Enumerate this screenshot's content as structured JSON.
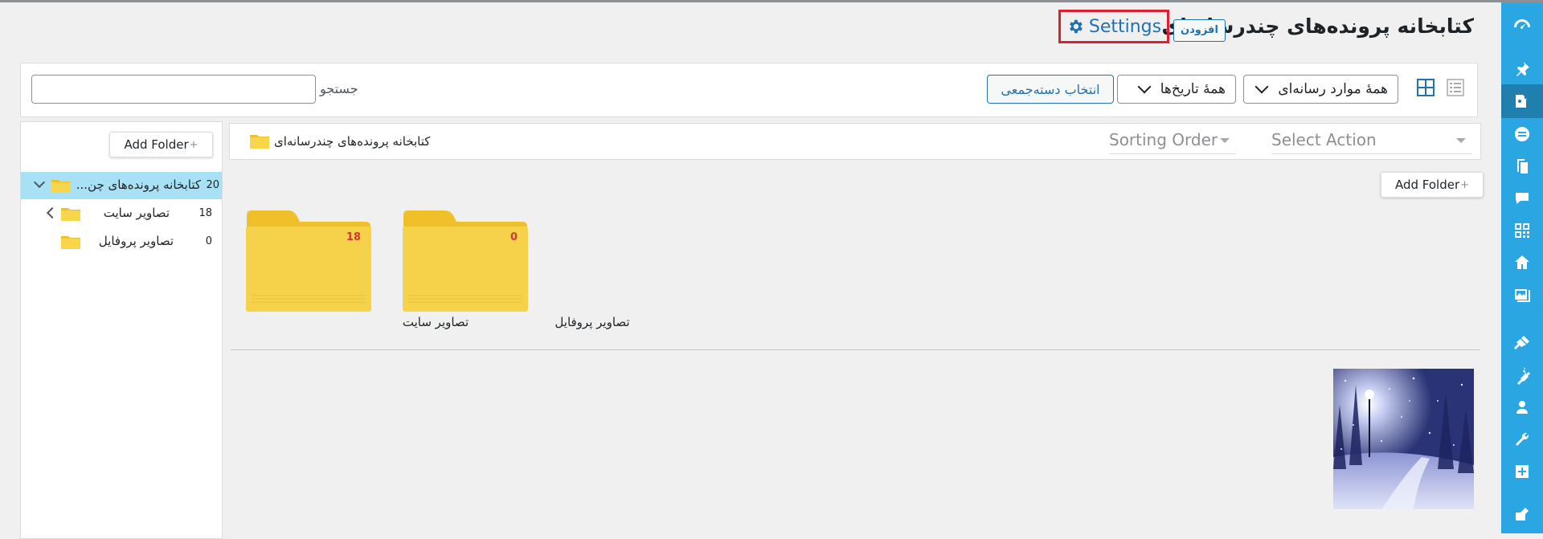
{
  "page_title": "کتابخانه پرونده‌های چندرسانه‌ای",
  "add_new_label": "افزودن",
  "settings_label": "Settings",
  "toolbar": {
    "media_type_select": "همهٔ موارد رسانه‌ای",
    "date_select": "همهٔ تاریخ‌ها",
    "bulk_select_label": "انتخاب دسته‌جمعی",
    "search_label": "جستجو",
    "search_value": ""
  },
  "sidebar_tree": {
    "add_folder_label": "Add Folder",
    "root": {
      "label": "کتابخانه پرونده‌های چن...",
      "count": "20"
    },
    "children": [
      {
        "label": "تصاویر سایت",
        "count": "18"
      },
      {
        "label": "تصاویر پروفایل",
        "count": "0"
      }
    ]
  },
  "content": {
    "breadcrumb": "کتابخانه پرونده‌های چندرسانه‌ای",
    "select_action_placeholder": "Select Action",
    "sorting_order_placeholder": "Sorting Order",
    "add_folder_label": "Add Folder",
    "folders": [
      {
        "name": "تصاویر سایت",
        "count": "18"
      },
      {
        "name": "تصاویر پروفایل",
        "count": "0"
      }
    ]
  },
  "admin_menu_icons": [
    "dashboard-icon",
    "pin-icon",
    "media-icon",
    "forms-icon",
    "pages-icon",
    "comments-icon",
    "qr-icon",
    "home-icon",
    "gallery-icon",
    "appearance-icon",
    "plugins-icon",
    "users-icon",
    "tools-icon",
    "settings-icon",
    "extra-icon"
  ],
  "colors": {
    "accent": "#2271b1",
    "admin_bar": "#2aa7e3",
    "selected_row": "#a8e1f6",
    "highlight_border": "#e02030",
    "folder_yellow": "#f5d24a",
    "count_red": "#d63638"
  }
}
